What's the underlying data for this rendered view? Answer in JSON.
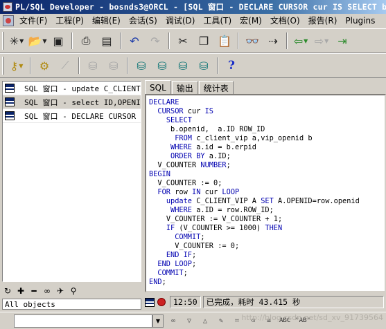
{
  "window": {
    "title": "PL/SQL Developer - bosnds3@ORCL - [SQL 窗口 - DECLARE CURSOR cur IS SELECT b.o"
  },
  "menu": {
    "items": [
      "文件(F)",
      "工程(P)",
      "编辑(E)",
      "会话(S)",
      "调试(D)",
      "工具(T)",
      "宏(M)",
      "文档(O)",
      "报告(R)",
      "Plugins"
    ]
  },
  "toolbar1": {
    "icons": [
      "new-icon",
      "open-folder-icon",
      "save-icon",
      "print-icon",
      "print-preview-icon",
      "undo-icon",
      "redo-icon",
      "cut-icon",
      "copy-icon",
      "paste-icon",
      "find-icon",
      "find-replace-icon",
      "back-icon",
      "forward-icon",
      "save-file-icon"
    ]
  },
  "toolbar2": {
    "icons": [
      "key-icon",
      "compile-gear-icon",
      "pin-icon",
      "execute-icon",
      "stop-icon",
      "db-connect-icon",
      "sql-db-icon",
      "find-db-icon",
      "refresh-db-icon",
      "help-icon"
    ],
    "help_glyph": "?"
  },
  "windows_list": [
    {
      "label": "SQL 窗口 - update C_CLIENT_VI"
    },
    {
      "label": "SQL 窗口 - select ID,OPENID,O"
    },
    {
      "label": "SQL 窗口 - DECLARE CURSOR cur"
    }
  ],
  "left_bottom": {
    "icons": [
      "refresh-icon",
      "add-icon",
      "remove-icon",
      "binoculars-icon",
      "next-icon",
      "filter-icon"
    ],
    "object_filter": "All objects"
  },
  "tabs": [
    "SQL",
    "输出",
    "统计表"
  ],
  "code_lines": [
    {
      "indent": "",
      "tokens": [
        {
          "t": "DECLARE",
          "k": "kw"
        }
      ]
    },
    {
      "indent": "  ",
      "tokens": [
        {
          "t": "CURSOR",
          "k": "kw"
        },
        {
          "t": " cur ",
          "k": ""
        },
        {
          "t": "IS",
          "k": "kw"
        }
      ]
    },
    {
      "indent": "    ",
      "tokens": [
        {
          "t": "SELECT",
          "k": "kw"
        }
      ]
    },
    {
      "indent": "     ",
      "tokens": [
        {
          "t": "b.openid,  a.ID ROW_ID",
          "k": ""
        }
      ]
    },
    {
      "indent": "      ",
      "tokens": [
        {
          "t": "FROM",
          "k": "kw"
        },
        {
          "t": " c_client_vip a,vip_openid b",
          "k": ""
        }
      ]
    },
    {
      "indent": "     ",
      "tokens": [
        {
          "t": "WHERE",
          "k": "kw"
        },
        {
          "t": " a.id = b.erpid",
          "k": ""
        }
      ]
    },
    {
      "indent": "     ",
      "tokens": [
        {
          "t": "ORDER BY",
          "k": "kw"
        },
        {
          "t": " a.ID;",
          "k": ""
        }
      ]
    },
    {
      "indent": "  ",
      "tokens": [
        {
          "t": "V_COUNTER ",
          "k": ""
        },
        {
          "t": "NUMBER",
          "k": "kw"
        },
        {
          "t": ";",
          "k": ""
        }
      ]
    },
    {
      "indent": "",
      "tokens": [
        {
          "t": "BEGIN",
          "k": "kw"
        }
      ]
    },
    {
      "indent": "  ",
      "tokens": [
        {
          "t": "V_COUNTER := 0;",
          "k": ""
        }
      ]
    },
    {
      "indent": "  ",
      "tokens": [
        {
          "t": "FOR",
          "k": "kw"
        },
        {
          "t": " row ",
          "k": ""
        },
        {
          "t": "IN",
          "k": "kw"
        },
        {
          "t": " cur ",
          "k": ""
        },
        {
          "t": "LOOP",
          "k": "kw"
        }
      ]
    },
    {
      "indent": "    ",
      "tokens": [
        {
          "t": "update",
          "k": "kw"
        },
        {
          "t": " C_CLIENT_VIP A ",
          "k": ""
        },
        {
          "t": "SET",
          "k": "kw"
        },
        {
          "t": " A.OPENID=row.openid",
          "k": ""
        }
      ]
    },
    {
      "indent": "     ",
      "tokens": [
        {
          "t": "WHERE",
          "k": "kw"
        },
        {
          "t": " a.ID = row.ROW_ID;",
          "k": ""
        }
      ]
    },
    {
      "indent": "    ",
      "tokens": [
        {
          "t": "V_COUNTER := V_COUNTER + 1;",
          "k": ""
        }
      ]
    },
    {
      "indent": "    ",
      "tokens": [
        {
          "t": "IF",
          "k": "kw"
        },
        {
          "t": " (V_COUNTER >= 1000) ",
          "k": ""
        },
        {
          "t": "THEN",
          "k": "kw"
        }
      ]
    },
    {
      "indent": "      ",
      "tokens": [
        {
          "t": "COMMIT",
          "k": "kw"
        },
        {
          "t": ";",
          "k": ""
        }
      ]
    },
    {
      "indent": "      ",
      "tokens": [
        {
          "t": "V_COUNTER := 0;",
          "k": ""
        }
      ]
    },
    {
      "indent": "    ",
      "tokens": [
        {
          "t": "END IF",
          "k": "kw"
        },
        {
          "t": ";",
          "k": ""
        }
      ]
    },
    {
      "indent": "  ",
      "tokens": [
        {
          "t": "END LOOP",
          "k": "kw"
        },
        {
          "t": ";",
          "k": ""
        }
      ]
    },
    {
      "indent": "  ",
      "tokens": [
        {
          "t": "COMMIT",
          "k": "kw"
        },
        {
          "t": ";",
          "k": ""
        }
      ]
    },
    {
      "indent": "",
      "tokens": [
        {
          "t": "END",
          "k": "kw"
        },
        {
          "t": ";",
          "k": ""
        }
      ]
    }
  ],
  "status": {
    "time": "12:50",
    "message": "已完成，耗时 43.415 秒"
  },
  "findbar": {
    "buttons": [
      "find-prev-icon",
      "find-dropdown-icon",
      "find-next-icon",
      "match-case-icon",
      "whole-word-icon",
      "highlight-icon",
      "regex-icon"
    ],
    "text_buttons": [
      "ABC",
      "\"AB\""
    ],
    "watermark": "http://blog.csdn.net/sd_xv_91739564"
  },
  "colors": {
    "keyword": "#0000b0",
    "window_bg": "#d4d0c8",
    "title_start": "#0a246a",
    "title_end": "#a6caf0"
  }
}
